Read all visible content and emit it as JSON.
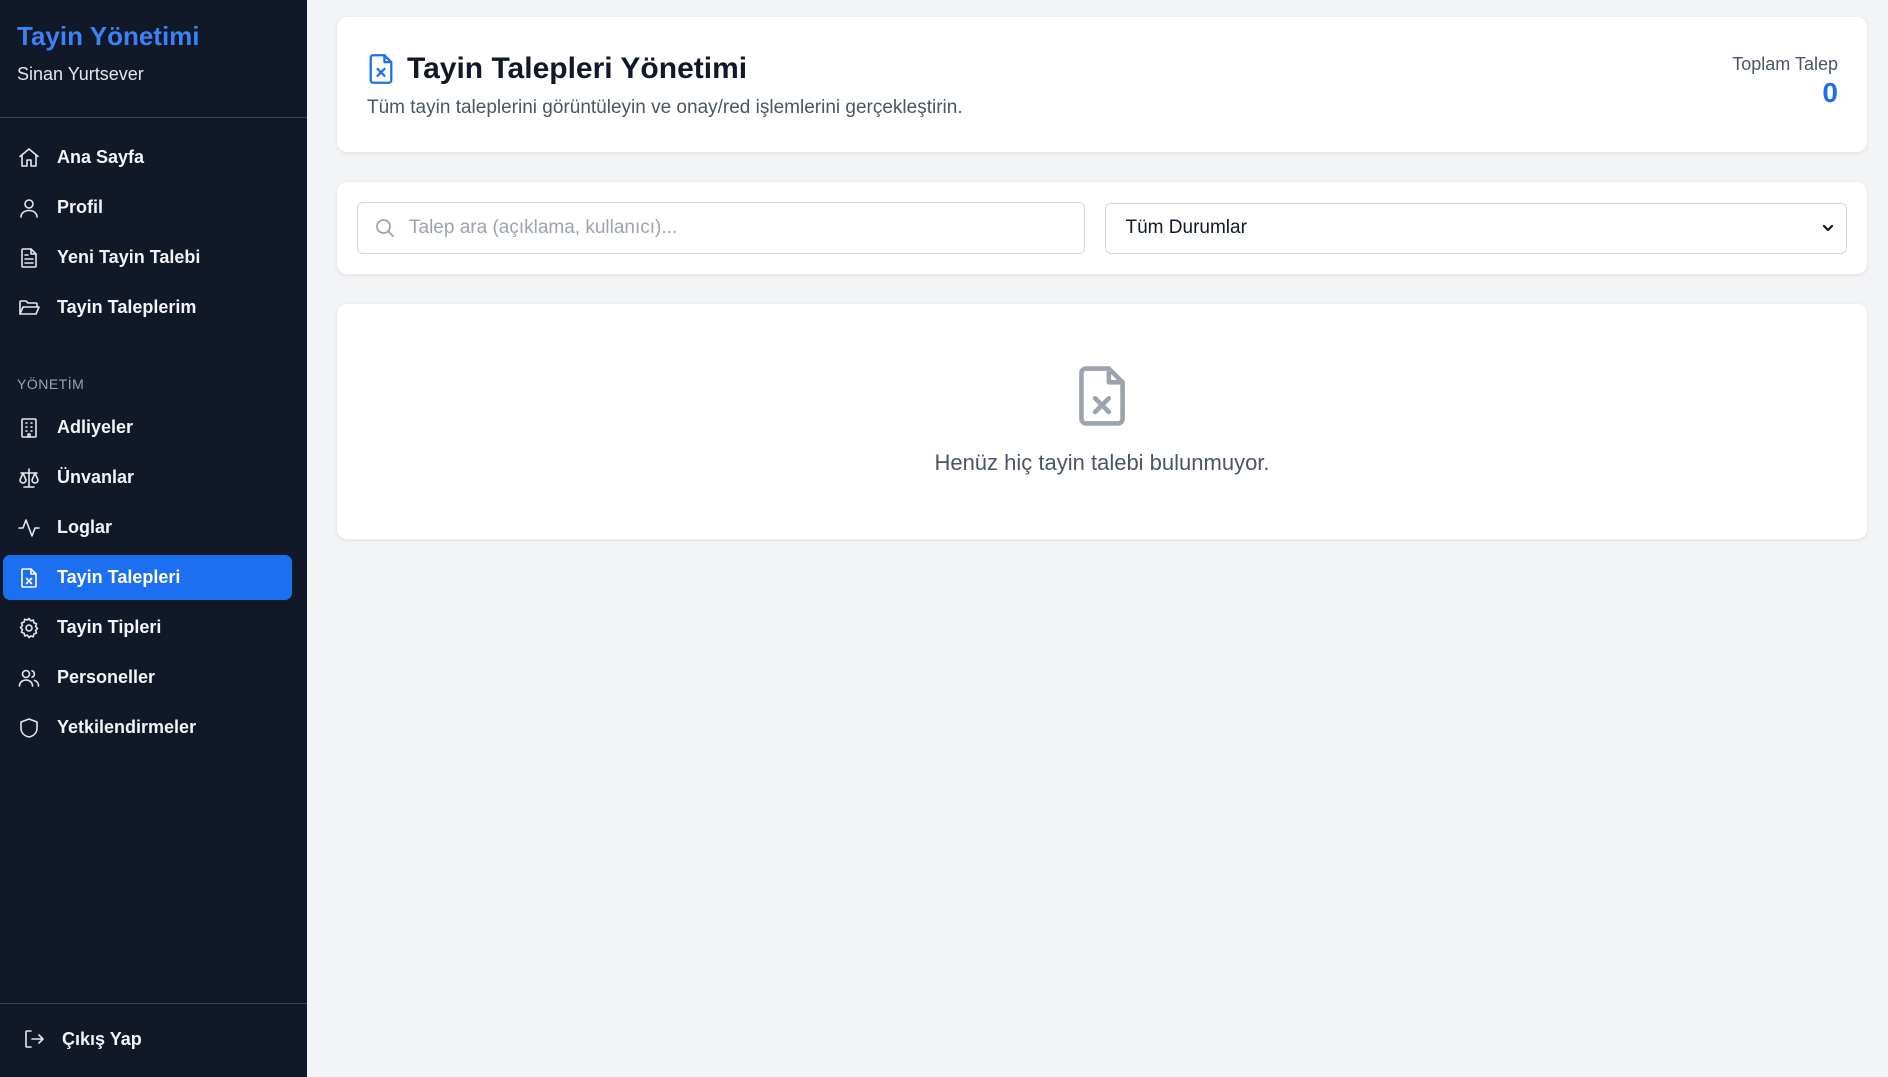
{
  "sidebar": {
    "title": "Tayin Yönetimi",
    "user": "Sinan Yurtsever",
    "items": [
      {
        "label": "Ana Sayfa",
        "icon": "home-icon"
      },
      {
        "label": "Profil",
        "icon": "user-icon"
      },
      {
        "label": "Yeni Tayin Talebi",
        "icon": "document-icon"
      },
      {
        "label": "Tayin Taleplerim",
        "icon": "folder-open-icon"
      }
    ],
    "section_label": "YÖNETİM",
    "admin_items": [
      {
        "label": "Adliyeler",
        "icon": "building-icon"
      },
      {
        "label": "Ünvanlar",
        "icon": "scale-icon"
      },
      {
        "label": "Loglar",
        "icon": "activity-icon"
      },
      {
        "label": "Tayin Talepleri",
        "icon": "file-x-icon",
        "active": true
      },
      {
        "label": "Tayin Tipleri",
        "icon": "gear-icon"
      },
      {
        "label": "Personeller",
        "icon": "users-icon"
      },
      {
        "label": "Yetkilendirmeler",
        "icon": "shield-icon"
      }
    ],
    "logout_label": "Çıkış Yap"
  },
  "header": {
    "title": "Tayin Talepleri Yönetimi",
    "subtitle": "Tüm tayin taleplerini görüntüleyin ve onay/red işlemlerini gerçekleştirin.",
    "stat_label": "Toplam Talep",
    "stat_value": "0"
  },
  "filters": {
    "search_placeholder": "Talep ara (açıklama, kullanıcı)...",
    "search_value": "",
    "status_selected": "Tüm Durumlar"
  },
  "empty_state": {
    "message": "Henüz hiç tayin talebi bulunmuyor."
  },
  "colors": {
    "sidebar_bg": "#111827",
    "brand": "#3b82f6",
    "accent": "#1d6ff2",
    "page_bg": "#f3f4f6"
  }
}
